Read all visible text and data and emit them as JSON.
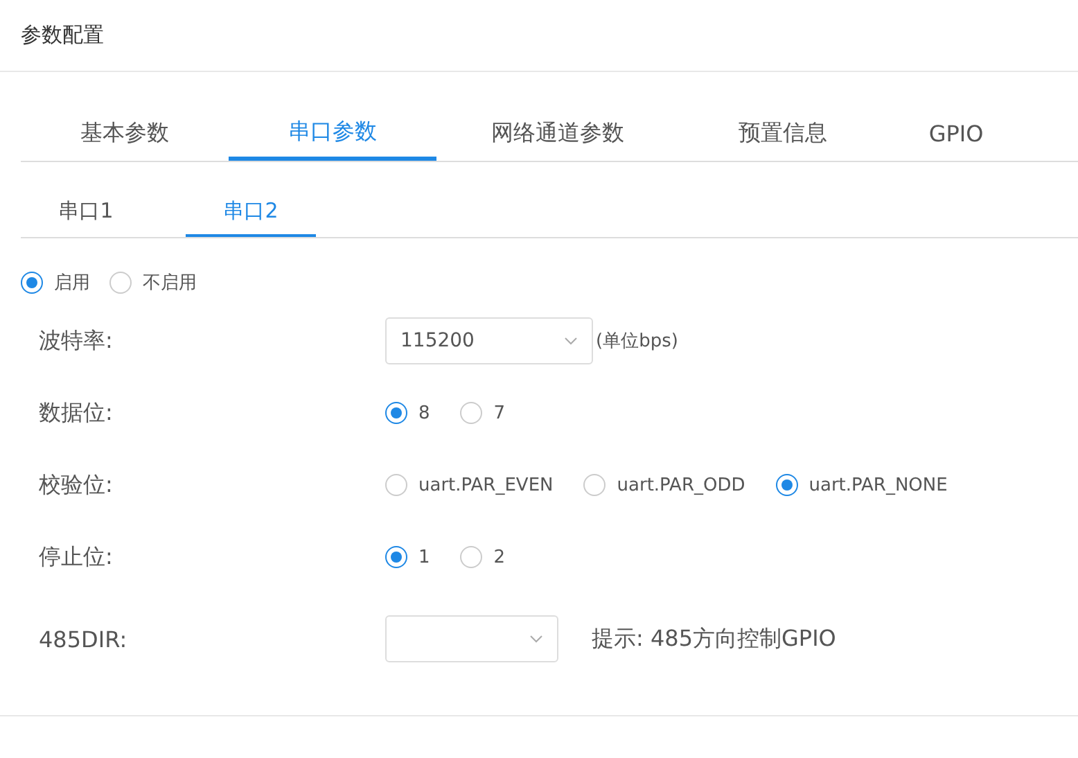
{
  "header": {
    "title": "参数配置"
  },
  "tabs": [
    {
      "label": "基本参数",
      "selected": false
    },
    {
      "label": "串口参数",
      "selected": true
    },
    {
      "label": "网络通道参数",
      "selected": false
    },
    {
      "label": "预置信息",
      "selected": false
    },
    {
      "label": "GPIO",
      "selected": false
    }
  ],
  "sub_tabs": [
    {
      "label": "串口1",
      "selected": false
    },
    {
      "label": "串口2",
      "selected": true
    }
  ],
  "enable_options": [
    {
      "label": "启用",
      "selected": true
    },
    {
      "label": "不启用",
      "selected": false
    }
  ],
  "fields": [
    {
      "kind": "select",
      "label": "波特率:",
      "value": "115200",
      "suffix": "(单位bps)"
    },
    {
      "kind": "radio",
      "label": "数据位:",
      "options": [
        {
          "label": "8",
          "selected": true
        },
        {
          "label": "7",
          "selected": false
        }
      ]
    },
    {
      "kind": "radio",
      "label": "校验位:",
      "options": [
        {
          "label": "uart.PAR_EVEN",
          "selected": false
        },
        {
          "label": "uart.PAR_ODD",
          "selected": false
        },
        {
          "label": "uart.PAR_NONE",
          "selected": true
        }
      ]
    },
    {
      "kind": "radio",
      "label": "停止位:",
      "options": [
        {
          "label": "1",
          "selected": true
        },
        {
          "label": "2",
          "selected": false
        }
      ]
    },
    {
      "kind": "select",
      "label": "485DIR:",
      "hint": "提示: 485方向控制GPIO"
    }
  ]
}
